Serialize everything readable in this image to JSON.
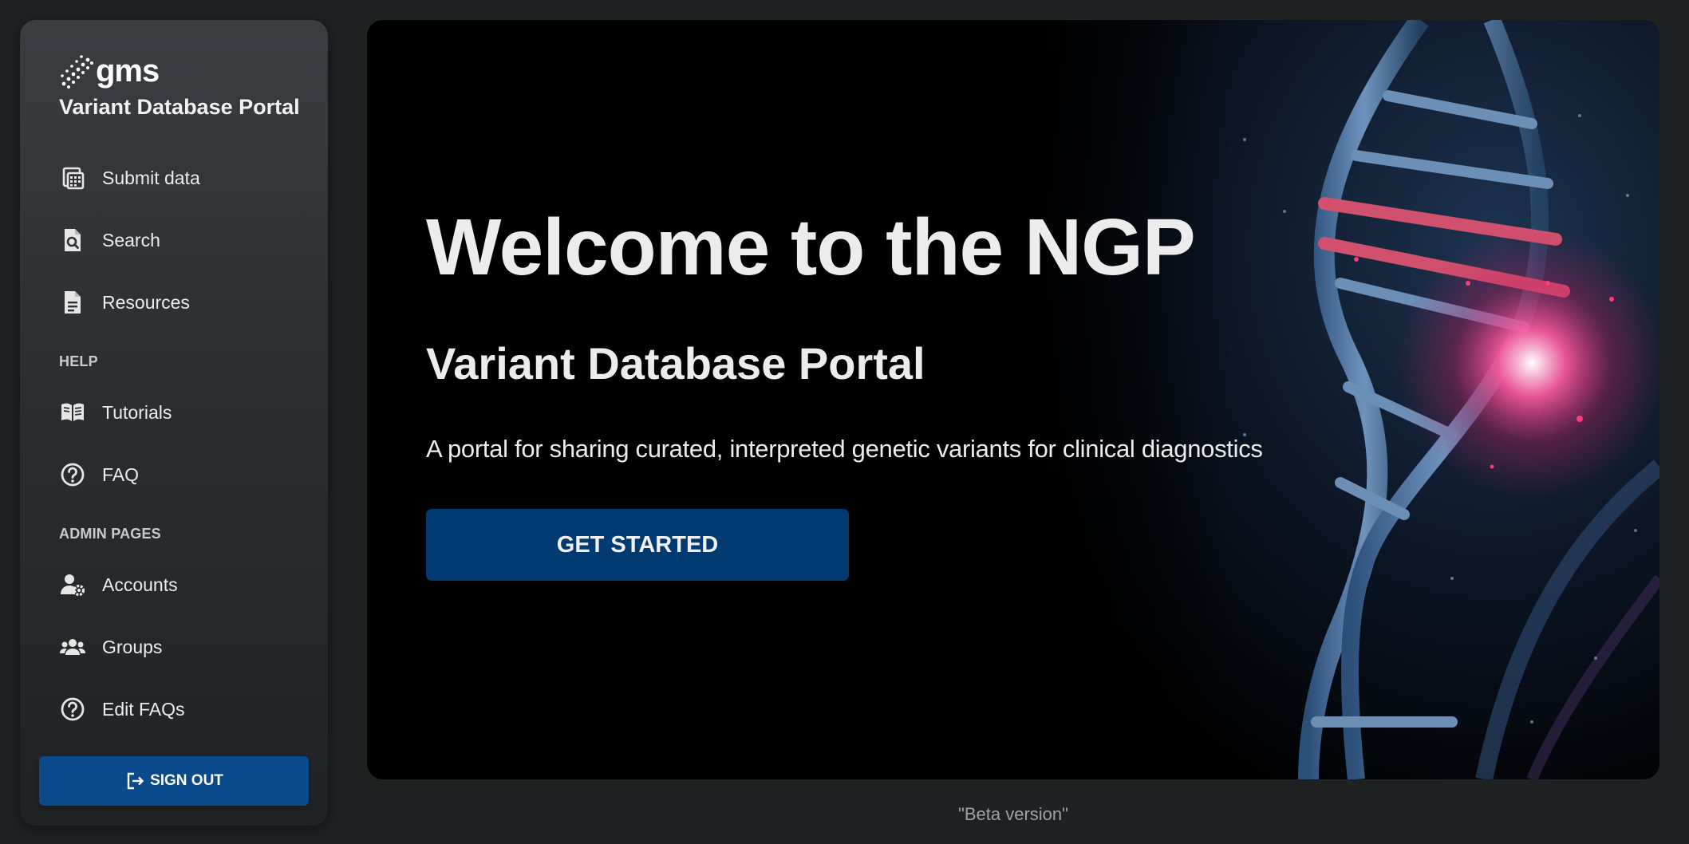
{
  "brand": {
    "logo_text": "gms",
    "portal_title": "Variant Database Portal"
  },
  "sidebar": {
    "items": [
      {
        "label": "Submit data",
        "icon": "submit-data-icon"
      },
      {
        "label": "Search",
        "icon": "search-document-icon"
      },
      {
        "label": "Resources",
        "icon": "document-icon"
      }
    ],
    "help_label": "HELP",
    "help_items": [
      {
        "label": "Tutorials",
        "icon": "book-icon"
      },
      {
        "label": "FAQ",
        "icon": "question-circle-icon"
      }
    ],
    "admin_label": "ADMIN PAGES",
    "admin_items": [
      {
        "label": "Accounts",
        "icon": "user-gear-icon"
      },
      {
        "label": "Groups",
        "icon": "users-icon"
      },
      {
        "label": "Edit FAQs",
        "icon": "question-circle-icon"
      }
    ],
    "signout_label": "SIGN OUT"
  },
  "hero": {
    "title": "Welcome to the NGP",
    "subtitle": "Variant Database Portal",
    "description": "A portal for sharing curated, interpreted genetic variants for clinical diagnostics",
    "cta_label": "GET STARTED"
  },
  "footer": {
    "note": "\"Beta version\""
  },
  "colors": {
    "background": "#1e2223",
    "accent": "#013a70",
    "signout": "#0a4a8c"
  }
}
